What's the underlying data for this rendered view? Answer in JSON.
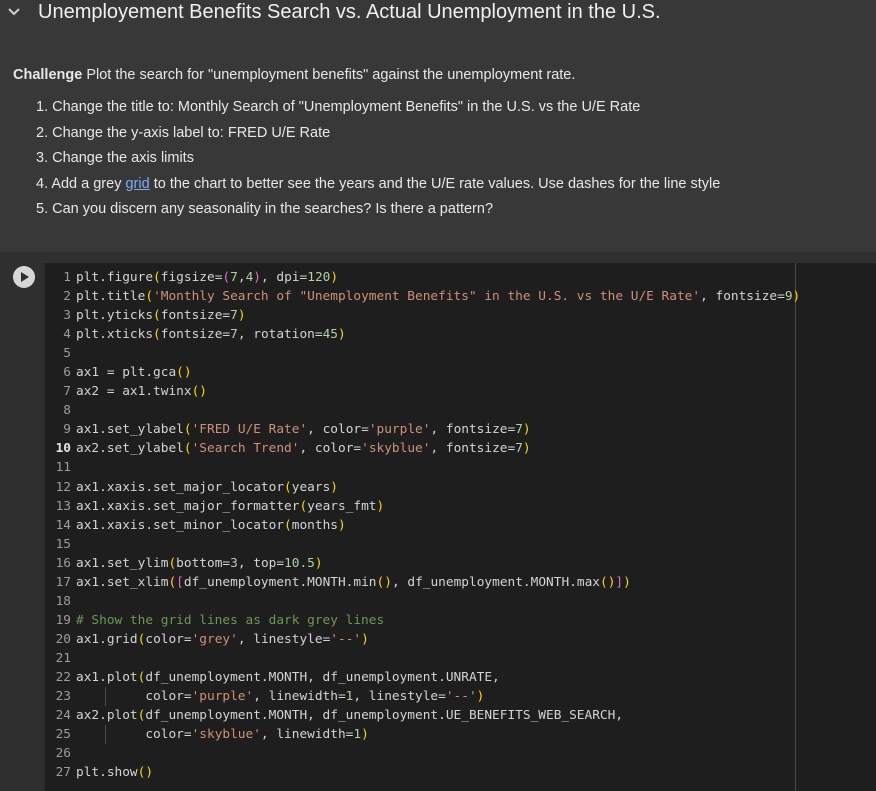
{
  "header": {
    "title": "Unemployement Benefits Search vs. Actual Unemployment in the U.S."
  },
  "challenge": {
    "label": "Challenge",
    "text": " Plot the search for \"unemployment benefits\" against the unemployment rate.",
    "tasks": [
      "1. Change the title to: Monthly Search of \"Unemployment Benefits\" in the U.S. vs the U/E Rate",
      "2. Change the y-axis label to: FRED U/E Rate",
      "3. Change the axis limits",
      "4. Add a grey ",
      "5. Can you discern any seasonality in the searches? Is there a pattern?"
    ],
    "task4_link": "grid",
    "task4_rest": " to the chart to better see the years and the U/E rate values. Use dashes for the line style"
  },
  "code": {
    "lines": [
      "plt.figure(figsize=(7,4), dpi=120)",
      "plt.title('Monthly Search of \"Unemployment Benefits\" in the U.S. vs the U/E Rate', fontsize=9)",
      "plt.yticks(fontsize=7)",
      "plt.xticks(fontsize=7, rotation=45)",
      "",
      "ax1 = plt.gca()",
      "ax2 = ax1.twinx()",
      "",
      "ax1.set_ylabel('FRED U/E Rate', color='purple', fontsize=7)",
      "ax2.set_ylabel('Search Trend', color='skyblue', fontsize=7)",
      "",
      "ax1.xaxis.set_major_locator(years)",
      "ax1.xaxis.set_major_formatter(years_fmt)",
      "ax1.xaxis.set_minor_locator(months)",
      "",
      "ax1.set_ylim(bottom=3, top=10.5)",
      "ax1.set_xlim([df_unemployment.MONTH.min(), df_unemployment.MONTH.max()])",
      "",
      "# Show the grid lines as dark grey lines",
      "ax1.grid(color='grey', linestyle='--')",
      "",
      "ax1.plot(df_unemployment.MONTH, df_unemployment.UNRATE,",
      "         color='purple', linewidth=1, linestyle='--')",
      "ax2.plot(df_unemployment.MONTH, df_unemployment.UE_BENEFITS_WEB_SEARCH,",
      "         color='skyblue', linewidth=1)",
      "",
      "plt.show()"
    ],
    "active_line": 10
  },
  "colors": {
    "string": "#ce9178",
    "number": "#b5cea8",
    "paren": "#ffd700",
    "paren2": "#da70d6",
    "comment": "#6a9955",
    "keyword": "#569cd6",
    "text": "#d4d4d4"
  }
}
